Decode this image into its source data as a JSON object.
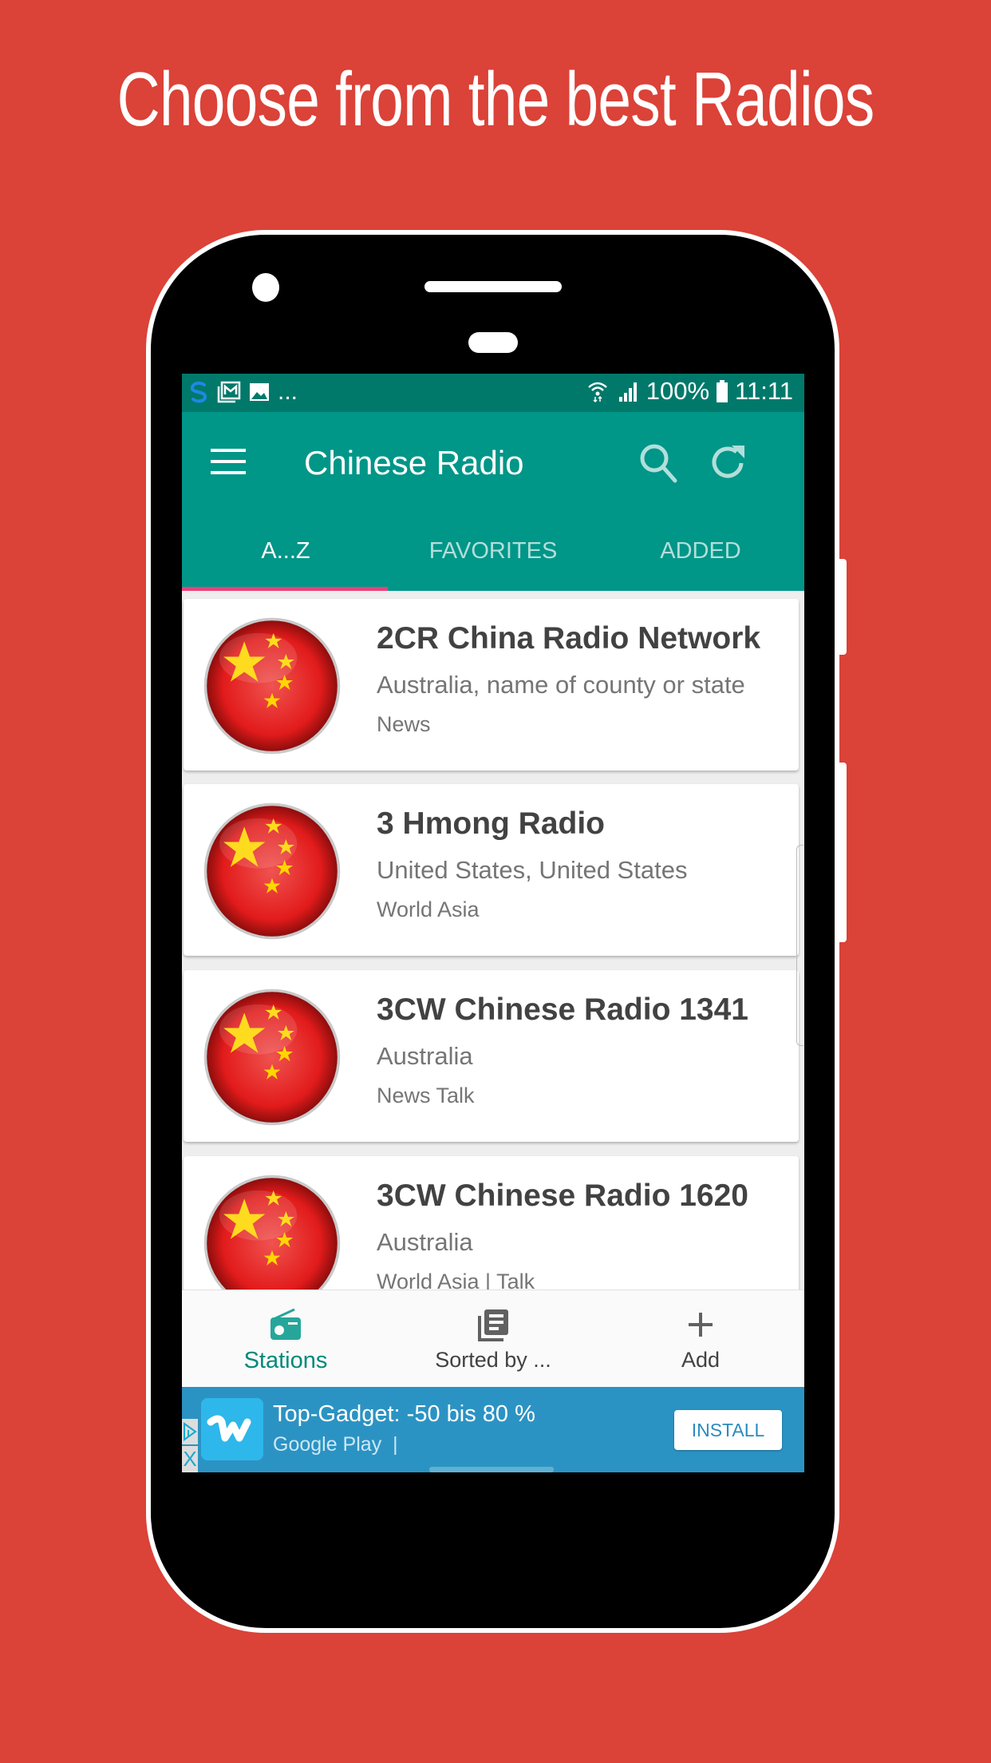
{
  "headline": "Choose from the best Radios",
  "status_bar": {
    "left_icons": [
      "sync-icon",
      "mail-icon",
      "gallery-icon"
    ],
    "overflow": "...",
    "battery": "100%",
    "time": "11:11"
  },
  "toolbar": {
    "title": "Chinese Radio",
    "menu_icon": "hamburger-menu-icon",
    "search_icon": "search-icon",
    "refresh_icon": "refresh-icon"
  },
  "tabs": [
    {
      "label": "A...Z",
      "active": true
    },
    {
      "label": "FAVORITES",
      "active": false
    },
    {
      "label": "ADDED",
      "active": false
    }
  ],
  "stations": [
    {
      "name": "2CR China Radio Network",
      "location": "Australia, name of county or state",
      "genre": "News",
      "icon": "china-flag-icon"
    },
    {
      "name": "3 Hmong Radio",
      "location": "United States, United States",
      "genre": "World Asia",
      "icon": "china-flag-icon"
    },
    {
      "name": "3CW Chinese Radio 1341",
      "location": "Australia",
      "genre": "News Talk",
      "icon": "china-flag-icon"
    },
    {
      "name": "3CW Chinese Radio 1620",
      "location": "Australia",
      "genre": "World Asia | Talk",
      "icon": "china-flag-icon"
    }
  ],
  "bottom_nav": [
    {
      "label": "Stations",
      "icon": "radio-icon",
      "active": true
    },
    {
      "label": "Sorted by ...",
      "icon": "library-icon",
      "active": false
    },
    {
      "label": "Add",
      "icon": "plus-icon",
      "active": false
    }
  ],
  "ad": {
    "title": "Top-Gadget: -50 bis 80 %",
    "subtitle": "Google Play",
    "separator": "|",
    "button": "INSTALL",
    "close": "X"
  },
  "colors": {
    "background": "#db4238",
    "primary": "#009688",
    "primary_dark": "#00796b",
    "accent": "#ec407a",
    "ad_blue": "#2b93c3"
  }
}
